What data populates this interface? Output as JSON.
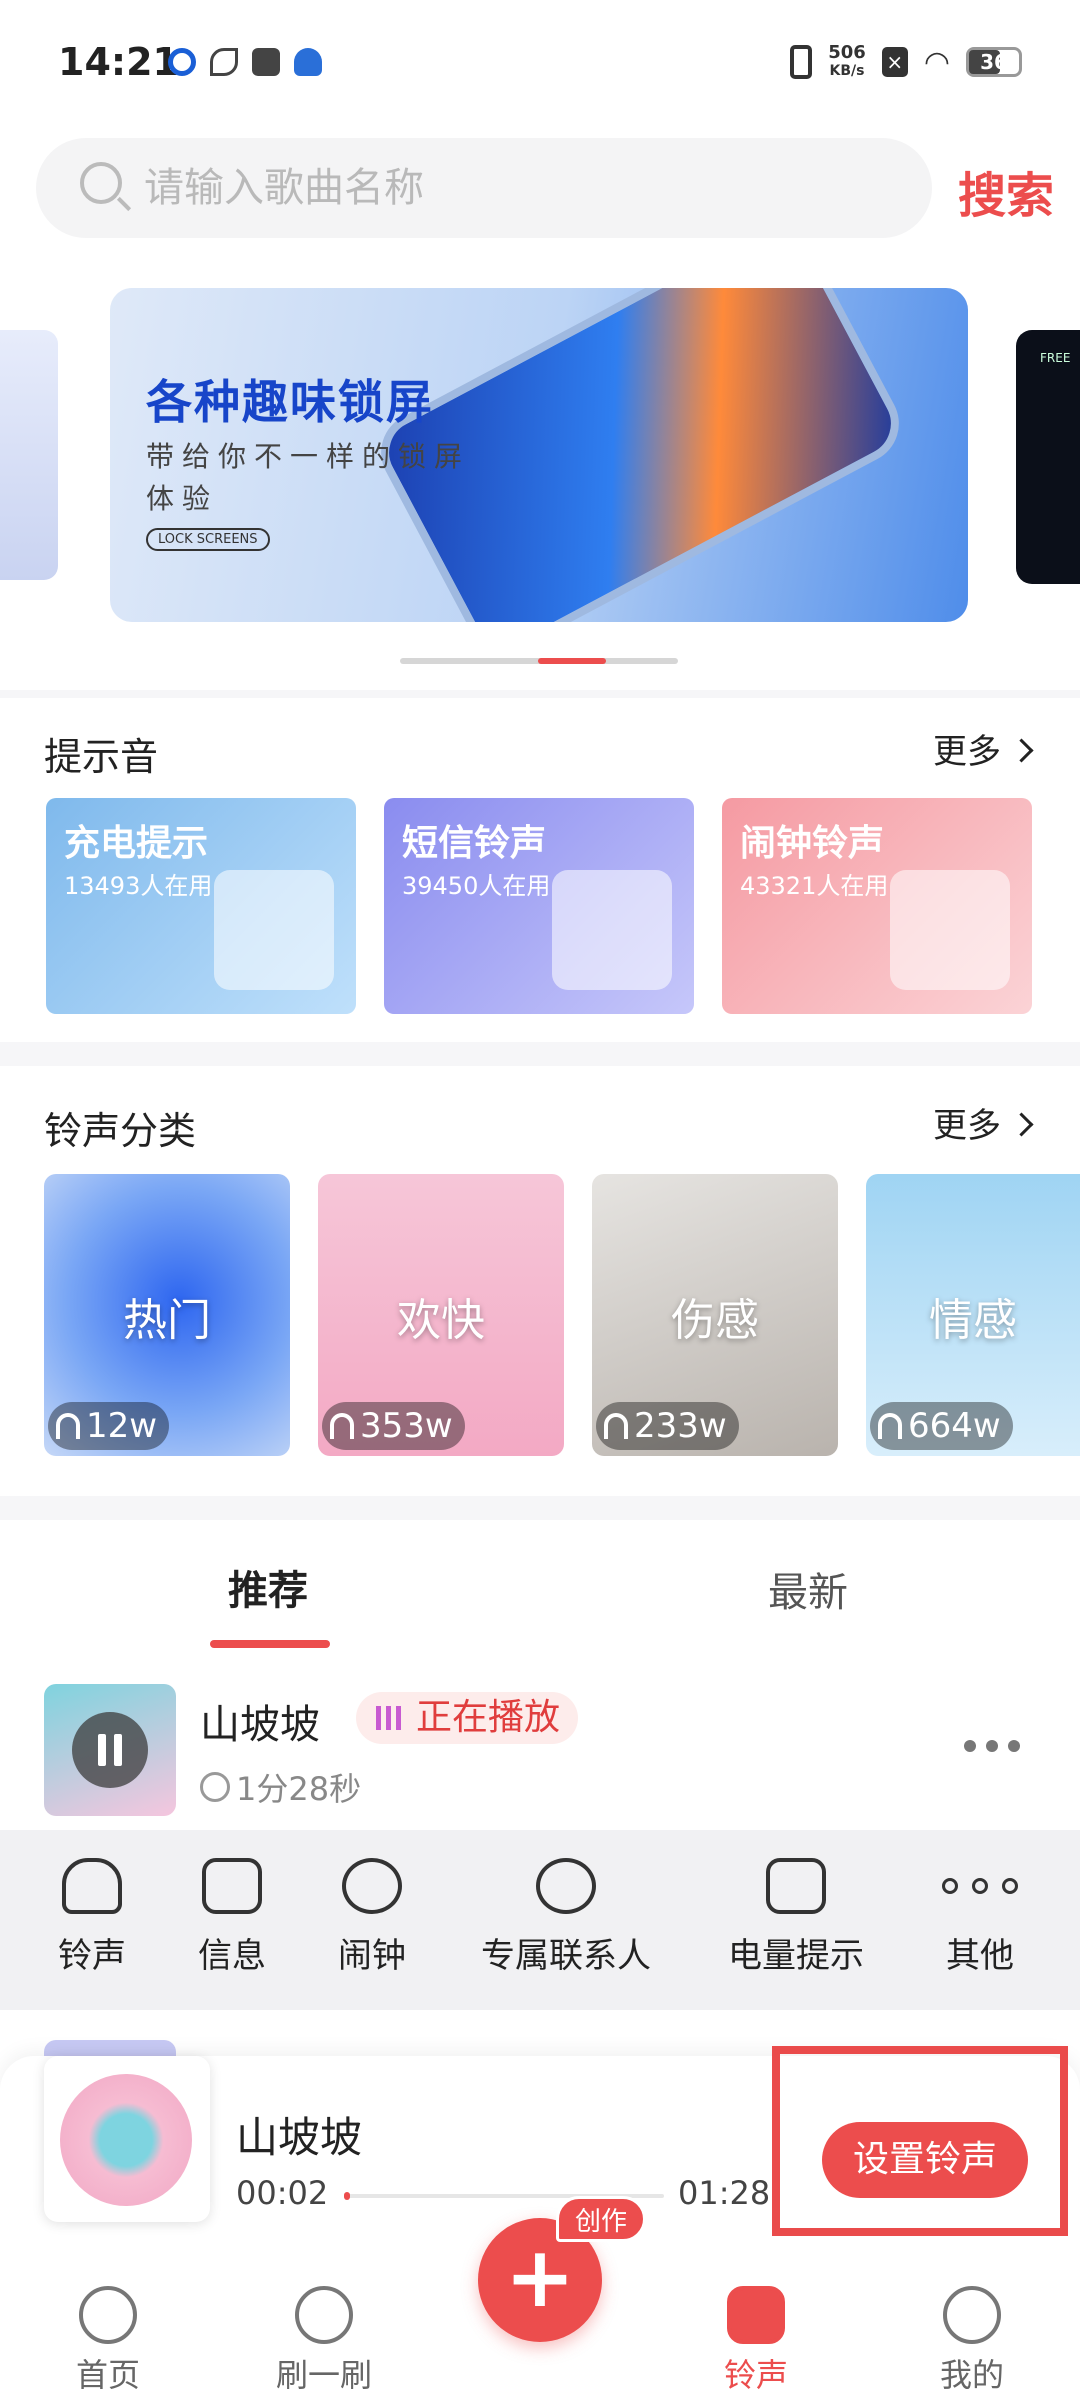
{
  "status_bar": {
    "time": "14:21",
    "net_speed_value": "506",
    "net_speed_unit": "KB/s",
    "battery": "36"
  },
  "search": {
    "placeholder": "请输入歌曲名称",
    "button": "搜索"
  },
  "banner": {
    "title": "各种趣味锁屏",
    "subtitle": "带给你不一样的锁屏体验",
    "tag": "LOCK SCREENS",
    "side_right_text": "FREE"
  },
  "notify_section": {
    "title": "提示音",
    "more": "更多",
    "cards": [
      {
        "name": "充电提示",
        "users": "13493人在用"
      },
      {
        "name": "短信铃声",
        "users": "39450人在用"
      },
      {
        "name": "闹钟铃声",
        "users": "43321人在用"
      }
    ]
  },
  "category_section": {
    "title": "铃声分类",
    "more": "更多",
    "cards": [
      {
        "name": "热门",
        "count": "12w"
      },
      {
        "name": "欢快",
        "count": "353w"
      },
      {
        "name": "伤感",
        "count": "233w"
      },
      {
        "name": "情感",
        "count": "664w"
      }
    ]
  },
  "tabs": {
    "recommend": "推荐",
    "latest": "最新"
  },
  "song": {
    "title": "山坡坡",
    "status": "正在播放",
    "duration": "1分28秒"
  },
  "actions": [
    "铃声",
    "信息",
    "闹钟",
    "专属联系人",
    "电量提示",
    "其他"
  ],
  "player": {
    "title": "山坡坡",
    "current": "00:02",
    "total": "01:28",
    "progress": 0.02,
    "set_button": "设置铃声"
  },
  "nav": {
    "home": "首页",
    "swipe": "刷一刷",
    "create_badge": "创作",
    "ringtone": "铃声",
    "mine": "我的"
  }
}
